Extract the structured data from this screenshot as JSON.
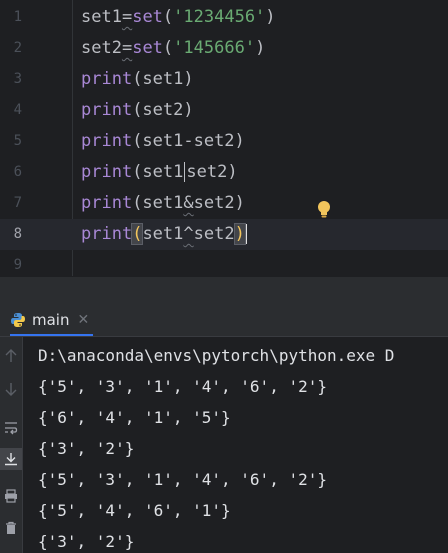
{
  "editor": {
    "lines": [
      {
        "num": "1",
        "parts": [
          {
            "t": "set1",
            "c": ""
          },
          {
            "t": "=",
            "c": "sq"
          },
          {
            "t": "set",
            "c": "kw"
          },
          {
            "t": "(",
            "c": ""
          },
          {
            "t": "'1234456'",
            "c": "str"
          },
          {
            "t": ")",
            "c": ""
          }
        ]
      },
      {
        "num": "2",
        "parts": [
          {
            "t": "set2",
            "c": ""
          },
          {
            "t": "=",
            "c": "sq"
          },
          {
            "t": "set",
            "c": "kw"
          },
          {
            "t": "(",
            "c": ""
          },
          {
            "t": "'145666'",
            "c": "str"
          },
          {
            "t": ")",
            "c": ""
          }
        ]
      },
      {
        "num": "3",
        "parts": [
          {
            "t": "print",
            "c": "kw"
          },
          {
            "t": "(set1)",
            "c": ""
          }
        ]
      },
      {
        "num": "4",
        "parts": [
          {
            "t": "print",
            "c": "kw"
          },
          {
            "t": "(set2)",
            "c": ""
          }
        ]
      },
      {
        "num": "5",
        "parts": [
          {
            "t": "print",
            "c": "kw"
          },
          {
            "t": "(set1-set2)",
            "c": ""
          }
        ]
      },
      {
        "num": "6",
        "parts": [
          {
            "t": "print",
            "c": "kw"
          },
          {
            "t": "(set1",
            "c": ""
          },
          {
            "t": "|",
            "c": "pipe"
          },
          {
            "t": "set2)",
            "c": ""
          }
        ]
      },
      {
        "num": "7",
        "parts": [
          {
            "t": "print",
            "c": "kw"
          },
          {
            "t": "(set1",
            "c": ""
          },
          {
            "t": "&",
            "c": "sq"
          },
          {
            "t": "set2)",
            "c": ""
          }
        ]
      },
      {
        "num": "8",
        "parts": [
          {
            "t": "print",
            "c": "kw"
          },
          {
            "t": "(",
            "c": "brace"
          },
          {
            "t": "set1",
            "c": ""
          },
          {
            "t": "^",
            "c": "sq"
          },
          {
            "t": "set2",
            "c": ""
          },
          {
            "t": ")",
            "c": "brace"
          }
        ]
      },
      {
        "num": "9",
        "parts": []
      }
    ],
    "current_line": 8
  },
  "run_panel": {
    "tab_label": "main",
    "icons": [
      "python-icon",
      "close-icon",
      "arrow-up-icon",
      "arrow-down-icon",
      "soft-wrap-icon",
      "scroll-to-end-icon",
      "print-icon",
      "trash-icon"
    ]
  },
  "console": {
    "lines": [
      "D:\\anaconda\\envs\\pytorch\\python.exe D",
      "{'5', '3', '1', '4', '6', '2'}",
      "{'6', '4', '1', '5'}",
      "{'3', '2'}",
      "{'5', '3', '1', '4', '6', '2'}",
      "{'5', '4', '6', '1'}",
      "{'3', '2'}"
    ]
  },
  "colors": {
    "editor_bg": "#1e1f22",
    "keyword": "#a988d6",
    "string": "#6aab73",
    "text": "#bcbec4",
    "bulb": "#f2c55c",
    "accent": "#3574f0"
  }
}
